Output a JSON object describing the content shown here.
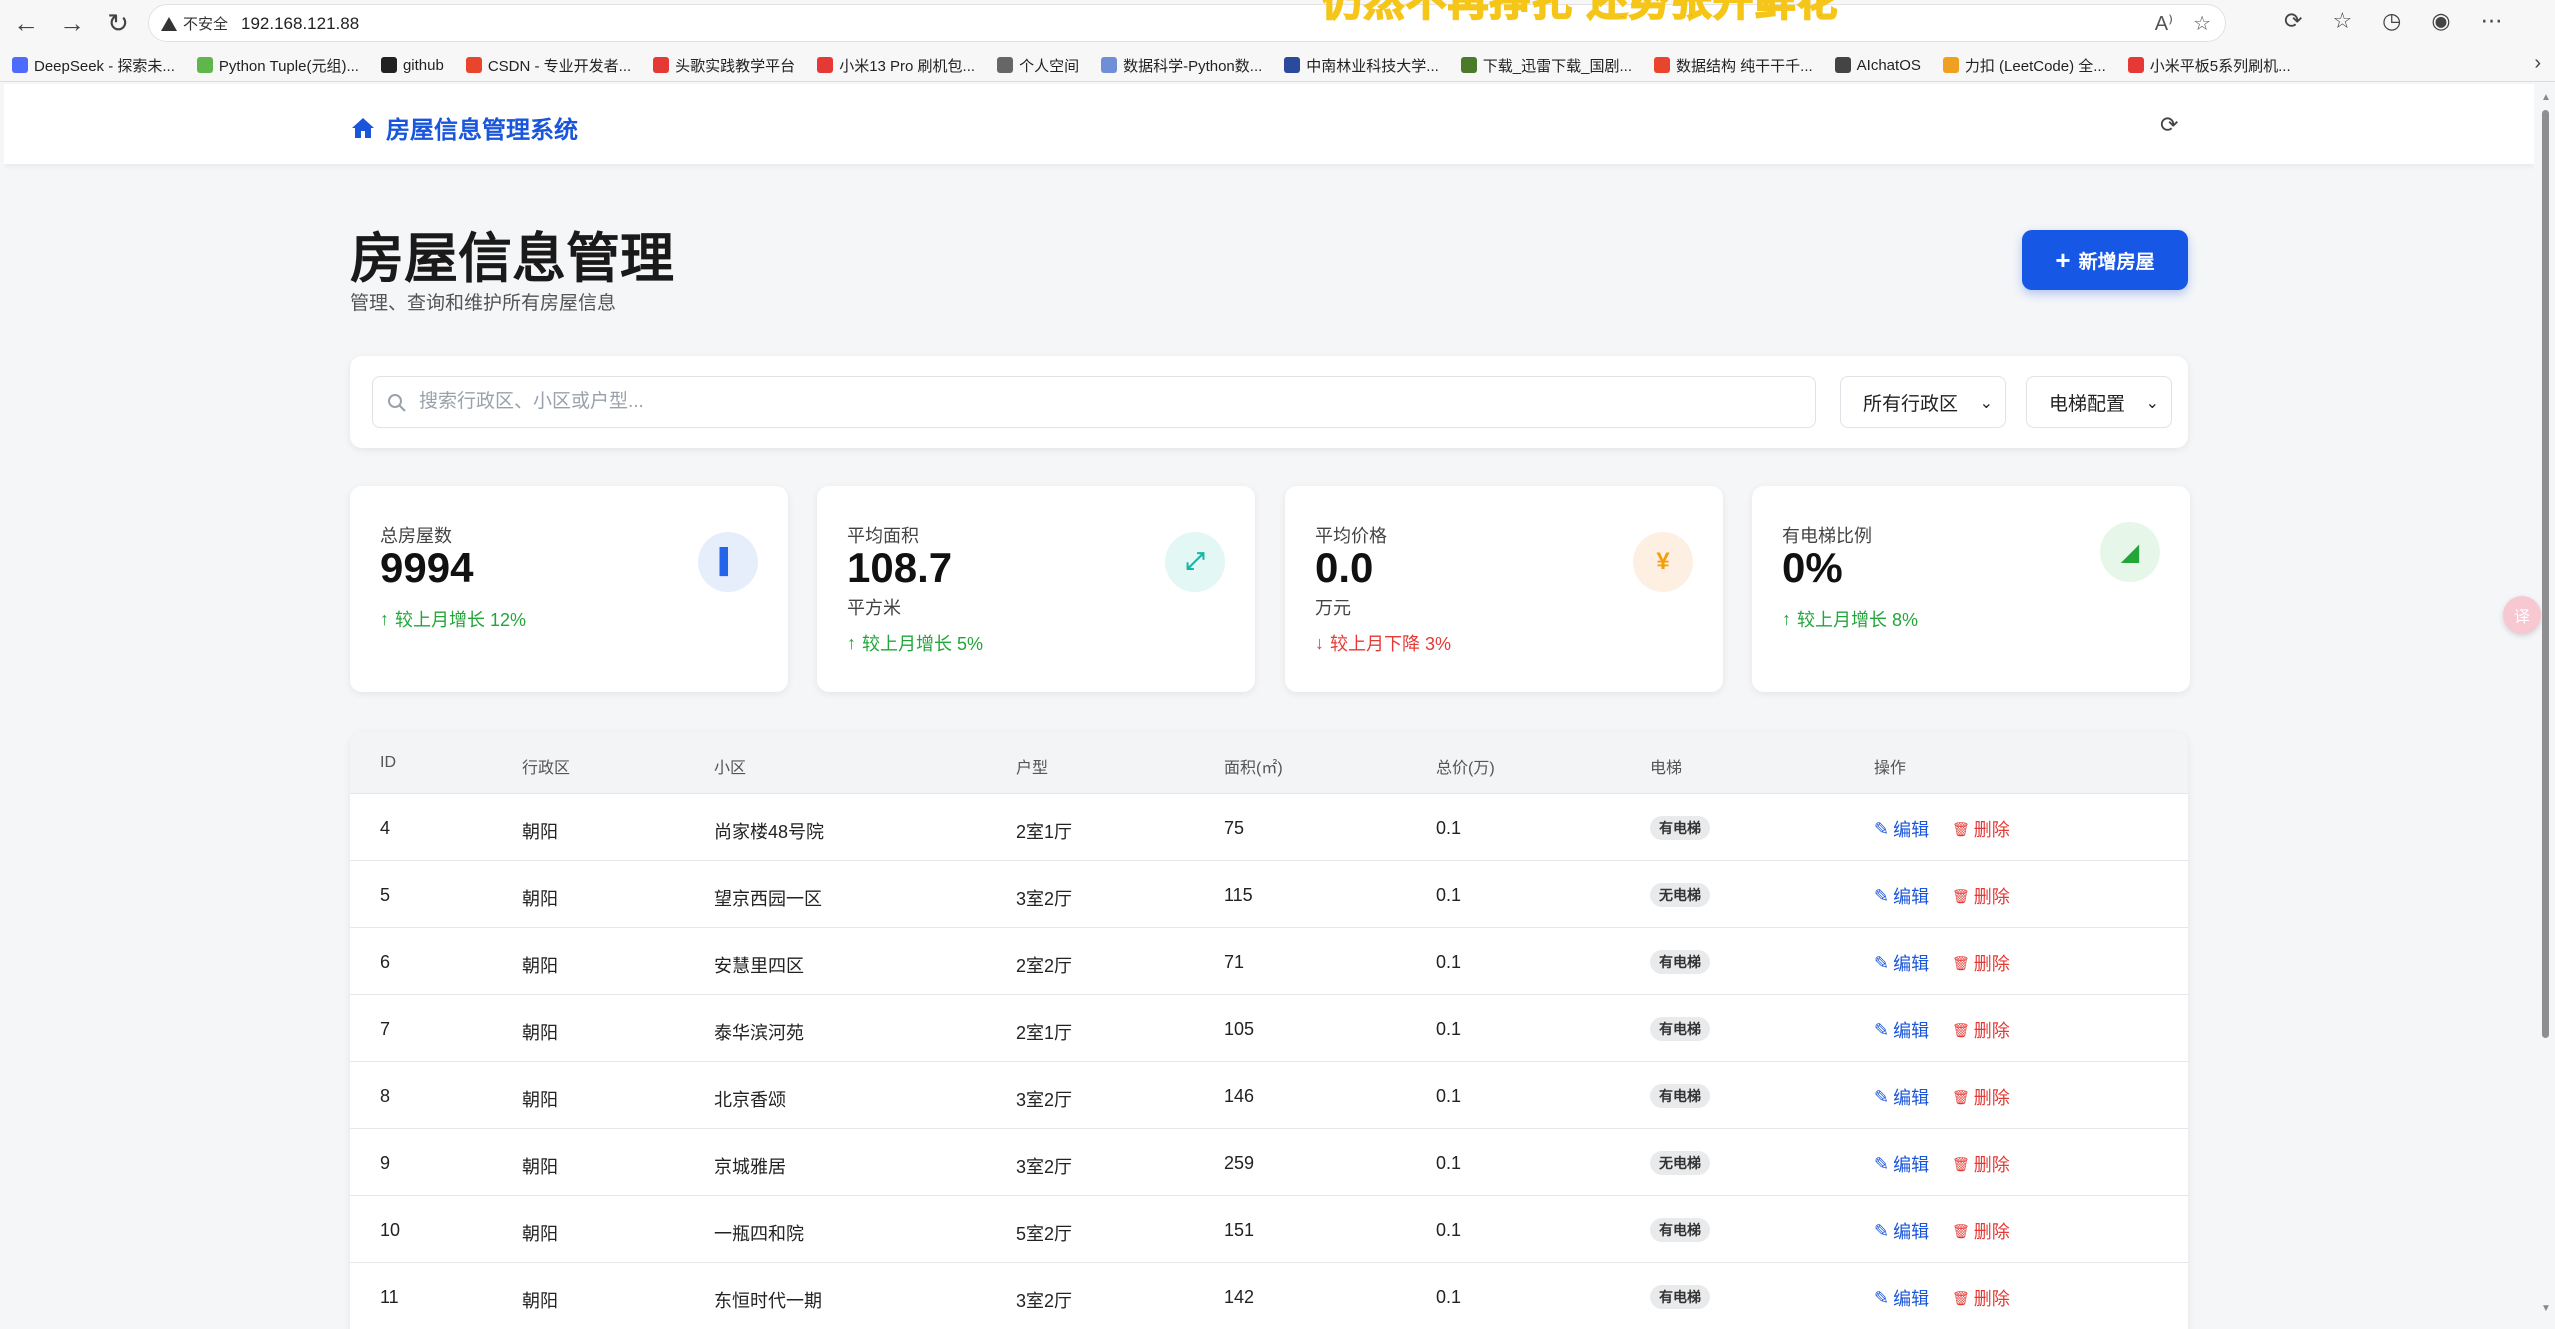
{
  "browser": {
    "security_label": "不安全",
    "url": "192.168.121.88",
    "banner_text": "仍然不再挣扎 还势张开鲜花",
    "bookmarks": [
      {
        "label": "DeepSeek - 探索未...",
        "color": "#4d6bfe"
      },
      {
        "label": "Python Tuple(元组)...",
        "color": "#5fb64a"
      },
      {
        "label": "github",
        "color": "#222222"
      },
      {
        "label": "CSDN - 专业开发者...",
        "color": "#e8452c"
      },
      {
        "label": "头歌实践教学平台",
        "color": "#e53935"
      },
      {
        "label": "小米13 Pro 刷机包...",
        "color": "#e53935"
      },
      {
        "label": "个人空间",
        "color": "#666666"
      },
      {
        "label": "数据科学-Python数...",
        "color": "#6e8fd8"
      },
      {
        "label": "中南林业科技大学...",
        "color": "#2b4a9b"
      },
      {
        "label": "下载_迅雷下载_国剧...",
        "color": "#4a7a2a"
      },
      {
        "label": "数据结构 纯干干千...",
        "color": "#e8452c"
      },
      {
        "label": "AIchatOS",
        "color": "#444444"
      },
      {
        "label": "力扣 (LeetCode) 全...",
        "color": "#f0a020"
      },
      {
        "label": "小米平板5系列刷机...",
        "color": "#e53935"
      }
    ]
  },
  "app": {
    "brand": "房屋信息管理系统",
    "title": "房屋信息管理",
    "subtitle": "管理、查询和维护所有房屋信息",
    "add_button": "新增房屋"
  },
  "filters": {
    "search_placeholder": "搜索行政区、小区或户型...",
    "district_select": "所有行政区",
    "elevator_select": "电梯配置"
  },
  "stats": [
    {
      "label": "总房屋数",
      "value": "9994",
      "unit": "",
      "trend": "较上月增长 12%",
      "direction": "up",
      "icon": "building-icon",
      "icon_color": "#2563eb",
      "icon_bg": "#e6eefc"
    },
    {
      "label": "平均面积",
      "value": "108.7",
      "unit": "平方米",
      "trend": "较上月增长 5%",
      "direction": "up",
      "icon": "expand-icon",
      "icon_color": "#14b8a6",
      "icon_bg": "#e3f7f4"
    },
    {
      "label": "平均价格",
      "value": "0.0",
      "unit": "万元",
      "trend": "较上月下降 3%",
      "direction": "down",
      "icon": "yen-icon",
      "icon_color": "#f59e0b",
      "icon_bg": "#fdf0e2"
    },
    {
      "label": "有电梯比例",
      "value": "0%",
      "unit": "",
      "trend": "较上月增长 8%",
      "direction": "up",
      "icon": "area-chart-icon",
      "icon_color": "#22a63a",
      "icon_bg": "#e6f6e8"
    }
  ],
  "table": {
    "headers": [
      "ID",
      "行政区",
      "小区",
      "户型",
      "面积(㎡)",
      "总价(万)",
      "电梯",
      "操作"
    ],
    "edit_label": "编辑",
    "delete_label": "删除",
    "rows": [
      {
        "id": "4",
        "district": "朝阳",
        "community": "尚家楼48号院",
        "layout": "2室1厅",
        "area": "75",
        "price": "0.1",
        "elevator": "有电梯"
      },
      {
        "id": "5",
        "district": "朝阳",
        "community": "望京西园一区",
        "layout": "3室2厅",
        "area": "115",
        "price": "0.1",
        "elevator": "无电梯"
      },
      {
        "id": "6",
        "district": "朝阳",
        "community": "安慧里四区",
        "layout": "2室2厅",
        "area": "71",
        "price": "0.1",
        "elevator": "有电梯"
      },
      {
        "id": "7",
        "district": "朝阳",
        "community": "泰华滨河苑",
        "layout": "2室1厅",
        "area": "105",
        "price": "0.1",
        "elevator": "有电梯"
      },
      {
        "id": "8",
        "district": "朝阳",
        "community": "北京香颂",
        "layout": "3室2厅",
        "area": "146",
        "price": "0.1",
        "elevator": "有电梯"
      },
      {
        "id": "9",
        "district": "朝阳",
        "community": "京城雅居",
        "layout": "3室2厅",
        "area": "259",
        "price": "0.1",
        "elevator": "无电梯"
      },
      {
        "id": "10",
        "district": "朝阳",
        "community": "一瓶四和院",
        "layout": "5室2厅",
        "area": "151",
        "price": "0.1",
        "elevator": "有电梯"
      },
      {
        "id": "11",
        "district": "朝阳",
        "community": "东恒时代一期",
        "layout": "3室2厅",
        "area": "142",
        "price": "0.1",
        "elevator": "有电梯"
      }
    ]
  },
  "floating_button": "译"
}
